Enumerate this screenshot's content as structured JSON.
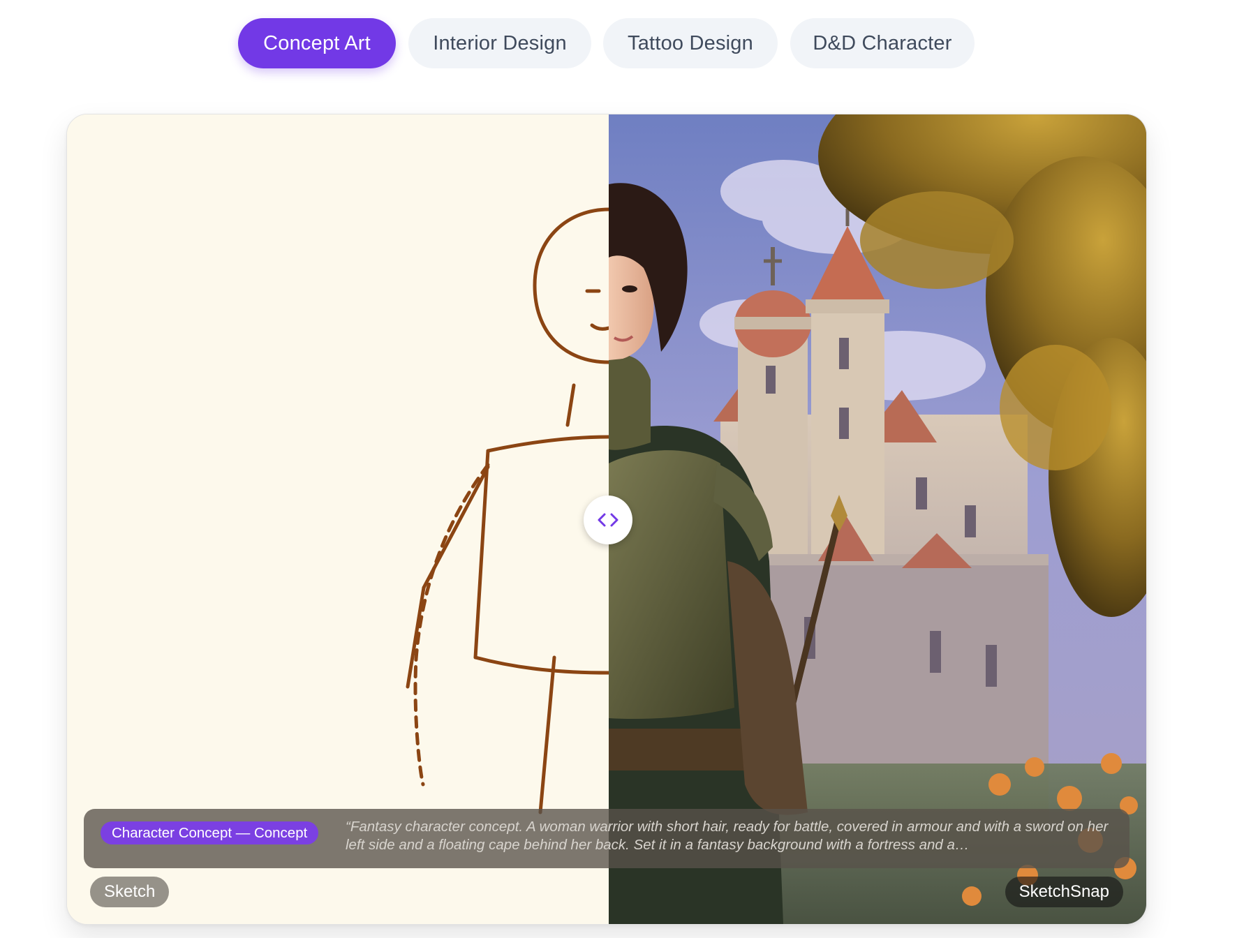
{
  "tabs": [
    {
      "label": "Concept Art",
      "active": true
    },
    {
      "label": "Interior Design",
      "active": false
    },
    {
      "label": "Tattoo Design",
      "active": false
    },
    {
      "label": "D&D Character",
      "active": false
    }
  ],
  "comparison": {
    "caption_badge": "Character Concept — Concept",
    "caption_prompt": "“Fantasy character concept. A woman warrior with short hair, ready for battle, covered in armour and with a sword on her left side and a floating cape behind her back. Set it in a fantasy background with a fortress and a…",
    "left_label": "Sketch",
    "right_label": "SketchSnap",
    "handle_icon": "chevron-left-right-icon"
  },
  "colors": {
    "accent": "#7239e6",
    "tab_inactive_bg": "#f1f4f8",
    "tab_inactive_text": "#3f4a5c",
    "sketch_bg": "#fdf9ec",
    "sketch_stroke": "#8b4513"
  }
}
